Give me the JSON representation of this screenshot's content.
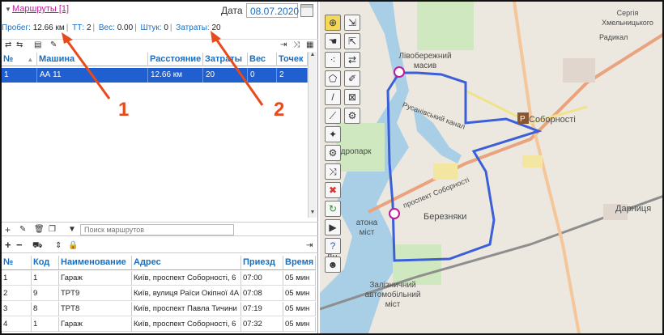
{
  "routes_panel": {
    "title": "Маршруты [1]",
    "date_label": "Дата",
    "date_value": "08.07.2020",
    "summary": [
      {
        "label": "Пробег:",
        "value": "12.66 км"
      },
      {
        "label": "ТТ:",
        "value": "2"
      },
      {
        "label": "Вес:",
        "value": "0.00"
      },
      {
        "label": "Штук:",
        "value": "0"
      },
      {
        "label": "Затраты:",
        "value": "20"
      }
    ],
    "columns": [
      "№",
      "Машина",
      "Расстояние",
      "Затраты",
      "Вес",
      "Точек"
    ],
    "rows": [
      [
        "1",
        "АА 11",
        "12.66 км",
        "20",
        "0",
        "2"
      ]
    ],
    "search_placeholder": "Поиск маршрутов"
  },
  "points_panel": {
    "columns": [
      "№",
      "Код",
      "Наименование",
      "Адрес",
      "Приезд",
      "Время с"
    ],
    "rows": [
      [
        "1",
        "1",
        "Гараж",
        "Київ, проспект Соборності, 6",
        "07:00",
        "05 мин"
      ],
      [
        "2",
        "9",
        "TPT9",
        "Київ, вулиця Раїси Окіпної 4А",
        "07:08",
        "05 мин"
      ],
      [
        "3",
        "8",
        "TPT8",
        "Київ, проспект Павла Тичини",
        "07:19",
        "05 мин"
      ],
      [
        "4",
        "1",
        "Гараж",
        "Київ, проспект Соборності, 6",
        "07:32",
        "05 мин"
      ]
    ]
  },
  "annotations": [
    "1",
    "2"
  ],
  "map": {
    "labels": {
      "livoberezhnyi": "Лівобережний масив",
      "hydropark": "Гідропарк",
      "sobornosti": "Соборності",
      "sobornosti_road": "проспект Соборності",
      "rusanivka": "Русанівський канал",
      "bereznyaky": "Березняки",
      "darnytsia": "Дарниця",
      "zaliznychnyi": "Залізничний автомобільний міст",
      "patona": "атона міст",
      "dn": "Дн",
      "khmelnytskogo": "Сергія Хмельницького",
      "radykal": "Радикал"
    },
    "route_color": "#3a5fd8",
    "river_color": "#a9cfe6",
    "tools": [
      "target-icon",
      "import-icon",
      "hand-icon",
      "export-icon",
      "points-icon",
      "swap-icon",
      "polygon-icon",
      "brush-icon",
      "pencil-icon",
      "clear-icon",
      "ruler-icon",
      "settings-icon",
      "magic-icon",
      "gear-bulb-icon",
      "shuffle-icon",
      "delete-icon",
      "refresh-icon",
      "play-icon",
      "help-icon",
      "owl-icon"
    ]
  }
}
